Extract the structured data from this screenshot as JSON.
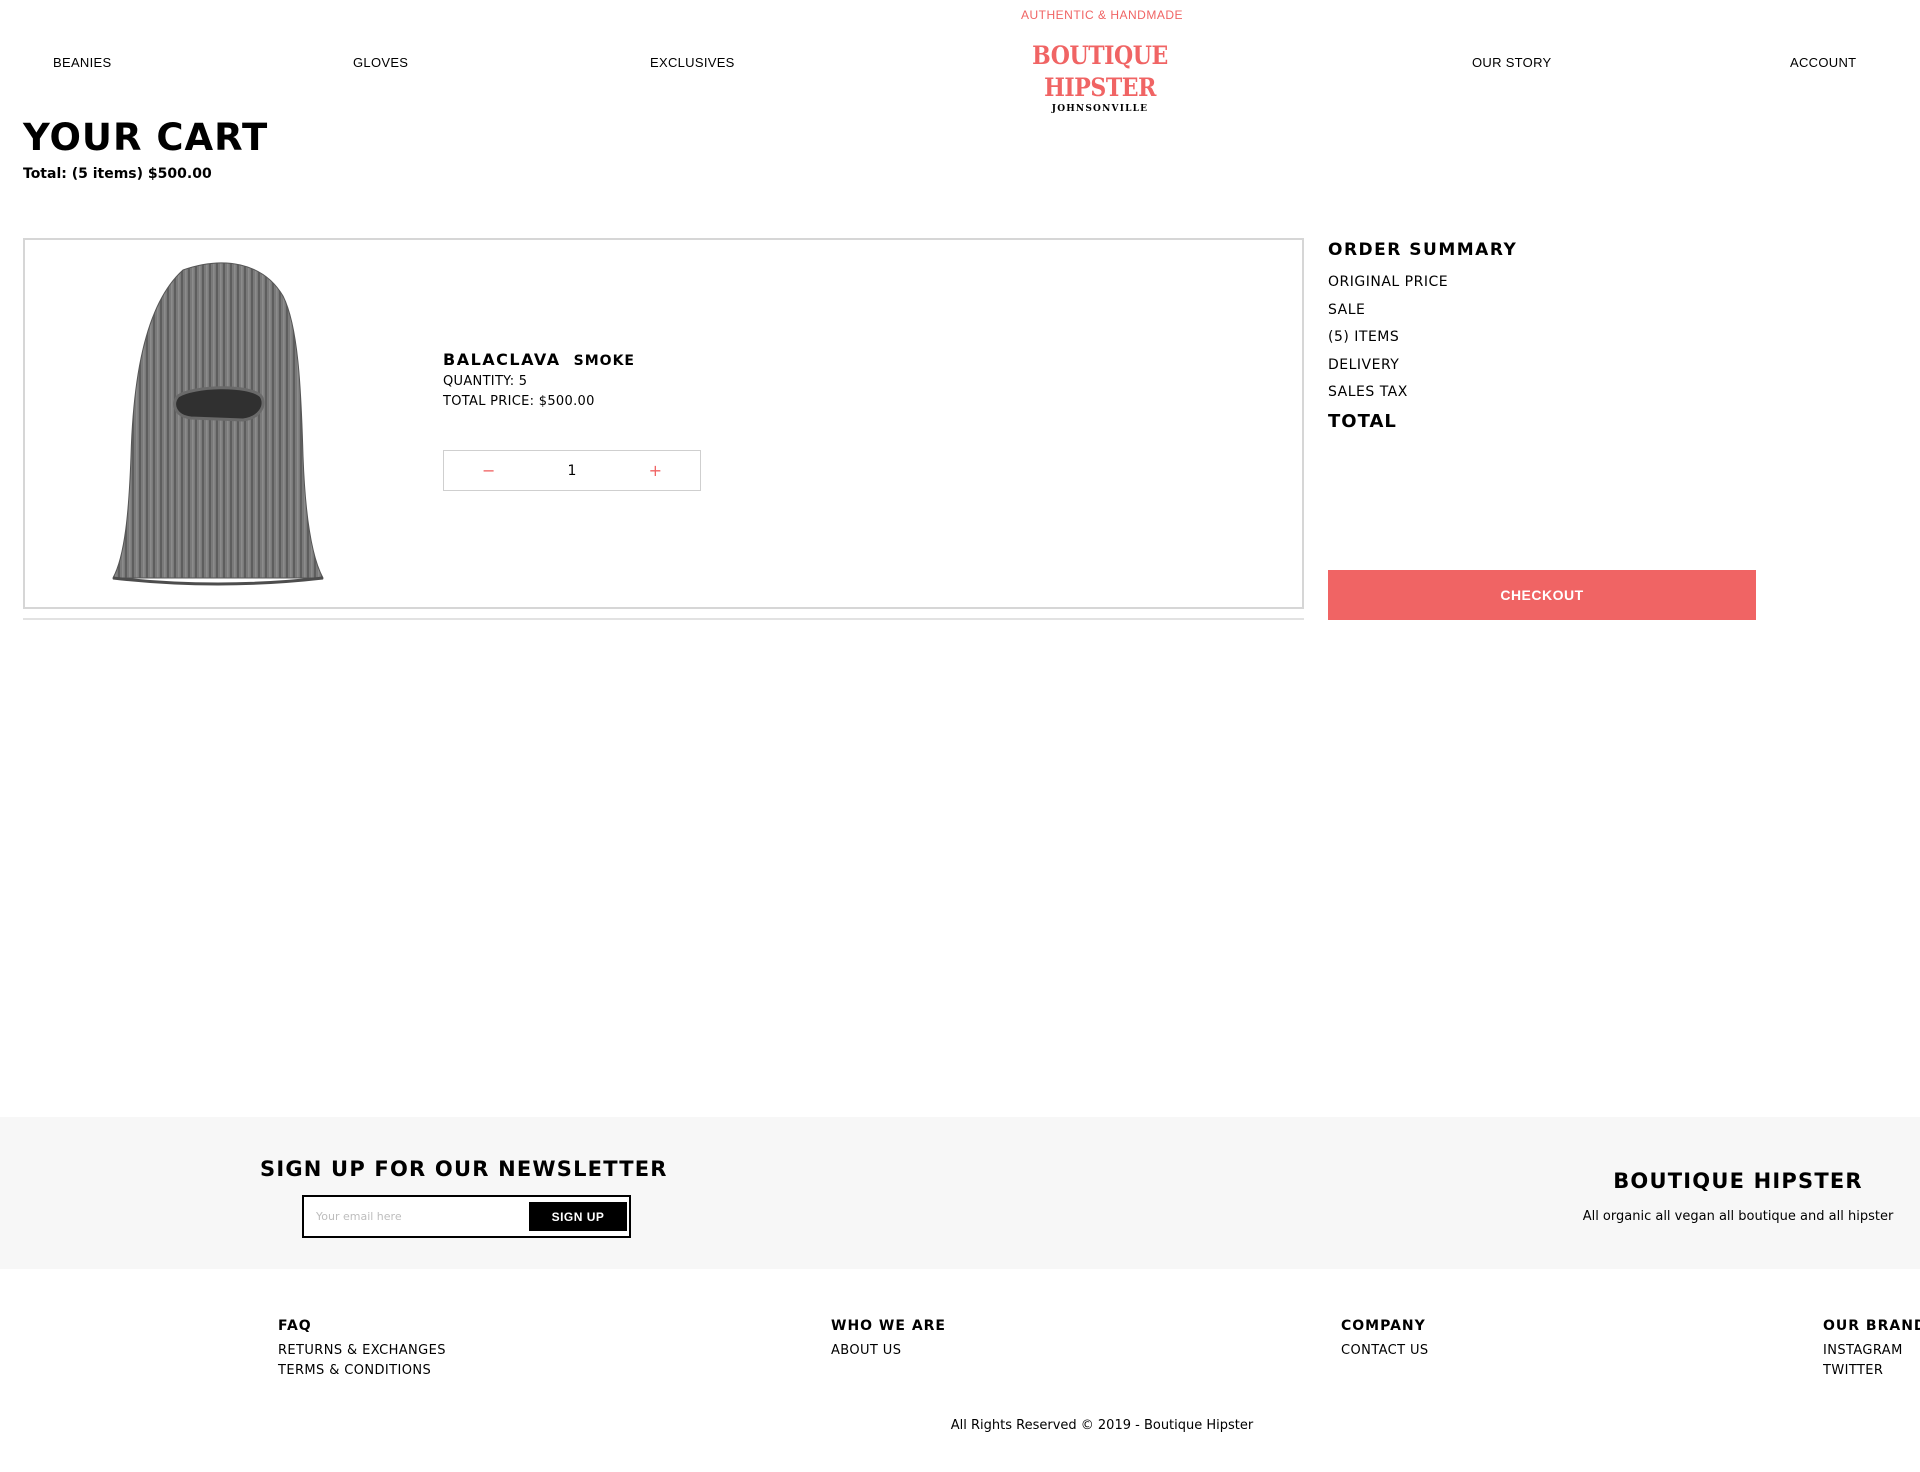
{
  "header": {
    "tagline": "AUTHENTIC & HANDMADE",
    "nav": {
      "beanies": "BEANIES",
      "gloves": "GLOVES",
      "exclusives": "EXCLUSIVES",
      "our_story": "OUR STORY",
      "account": "ACCOUNT"
    },
    "brand": {
      "name": "BOUTIQUE HIPSTER",
      "location": "JOHNSONVILLE"
    }
  },
  "cart": {
    "title": "YOUR CART",
    "total_line": "Total: (5 items) $500.00",
    "items": [
      {
        "name": "BALACLAVA",
        "color": "SMOKE",
        "quantity_line": "QUANTITY: 5",
        "total_price_line": "TOTAL PRICE: $500.00",
        "stepper": {
          "minus": "−",
          "value": "1",
          "plus": "+"
        },
        "image_icon": "balaclava-image"
      }
    ]
  },
  "summary": {
    "title": "ORDER SUMMARY",
    "rows": [
      "ORIGINAL PRICE",
      "SALE",
      "(5) ITEMS",
      "DELIVERY",
      "SALES TAX"
    ],
    "total_label": "TOTAL",
    "checkout_label": "CHECKOUT"
  },
  "newsletter": {
    "title": "SIGN UP FOR OUR NEWSLETTER",
    "placeholder": "Your email here",
    "button": "SIGN UP"
  },
  "brand_block": {
    "title": "BOUTIQUE HIPSTER",
    "subtitle": "All organic all vegan all boutique and all hipster"
  },
  "footer": {
    "columns": [
      {
        "title": "FAQ",
        "links": [
          "RETURNS & EXCHANGES",
          "TERMS & CONDITIONS"
        ]
      },
      {
        "title": "WHO WE ARE",
        "links": [
          "ABOUT US"
        ]
      },
      {
        "title": "COMPANY",
        "links": [
          "CONTACT US"
        ]
      },
      {
        "title": "OUR BRANDS",
        "links": [
          "INSTAGRAM",
          "TWITTER"
        ]
      }
    ],
    "copyright": "All Rights Reserved © 2019 - Boutique Hipster"
  },
  "colors": {
    "accent": "#f06464",
    "band": "#f7f7f7",
    "text": "#000000"
  }
}
